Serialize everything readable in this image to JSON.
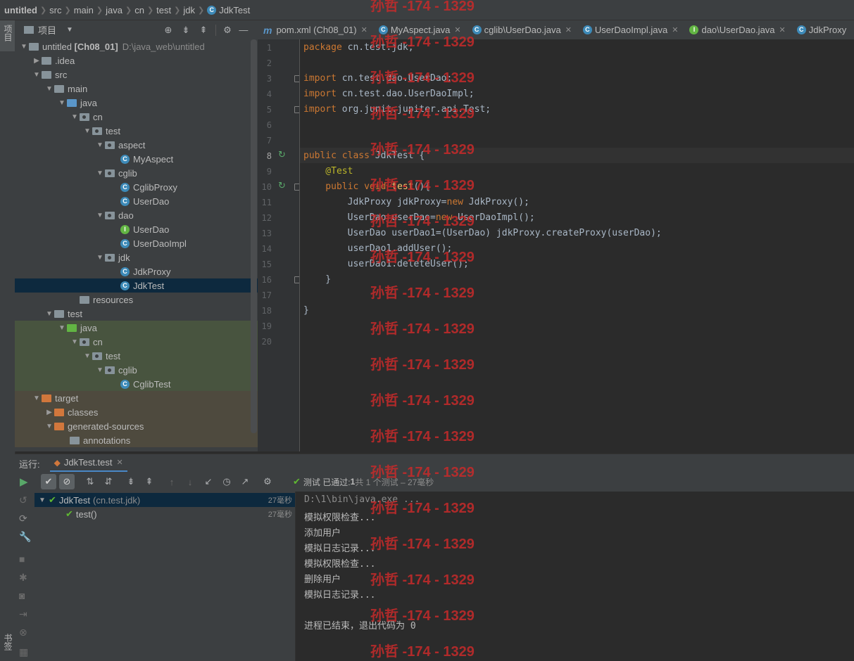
{
  "breadcrumb": [
    "untitled",
    "src",
    "main",
    "java",
    "cn",
    "test",
    "jdk",
    "JdkTest"
  ],
  "left_strip": {
    "project_label": "项目",
    "bookmarks_label": "书签"
  },
  "project_panel": {
    "title": "项目"
  },
  "tree": {
    "root_name": "untitled",
    "root_module": "[Ch08_01]",
    "root_path": "D:\\java_web\\untitled",
    "items": [
      ".idea",
      "src",
      "main",
      "java",
      "cn",
      "test",
      "aspect",
      "MyAspect",
      "cglib",
      "CglibProxy",
      "UserDao",
      "dao",
      "UserDao",
      "UserDaoImpl",
      "jdk",
      "JdkProxy",
      "JdkTest",
      "resources",
      "test",
      "java",
      "cn",
      "test",
      "cglib",
      "CglibTest",
      "target",
      "classes",
      "generated-sources",
      "annotations"
    ]
  },
  "tabs": [
    "pom.xml (Ch08_01)",
    "MyAspect.java",
    "cglib\\UserDao.java",
    "UserDaoImpl.java",
    "dao\\UserDao.java",
    "JdkProxy"
  ],
  "code": {
    "line_numbers": [
      "1",
      "2",
      "3",
      "4",
      "5",
      "6",
      "7",
      "8",
      "9",
      "10",
      "11",
      "12",
      "13",
      "14",
      "15",
      "16",
      "17",
      "18",
      "19",
      "20"
    ],
    "l1_kw": "package",
    "l1_rest": " cn.test.jdk;",
    "l3_kw": "import",
    "l3_rest": " cn.test.dao.UserDao;",
    "l4_kw": "import",
    "l4_rest": " cn.test.dao.UserDaoImpl;",
    "l5_kw": "import",
    "l5_rest": " org.junit.jupiter.api.Test;",
    "l8_kw": "public class",
    "l8_rest": " JdkTest {",
    "l9": "    @Test",
    "l10_kw": "    public void",
    "l10_fn": " test",
    "l10_rest": "(){",
    "l11_a": "        JdkProxy jdkProxy=",
    "l11_kw": "new",
    "l11_b": " JdkProxy();",
    "l12_a": "        UserDao userDao=",
    "l12_kw": "new",
    "l12_b": " UserDaoImpl();",
    "l13": "        UserDao userDao1=(UserDao) jdkProxy.createProxy(userDao);",
    "l14": "        userDao1.addUser();",
    "l15": "        userDao1.deleteUser();",
    "l16": "    }",
    "l18": "}"
  },
  "run": {
    "label": "运行:",
    "tab": "JdkTest.test",
    "status_a": "测试 已通过:",
    "status_b": "1",
    "status_c": "共 1 个测试 – 27毫秒",
    "tree": [
      {
        "name": "JdkTest",
        "detail": "(cn.test.jdk)",
        "time": "27毫秒"
      },
      {
        "name": "test()",
        "detail": "",
        "time": "27毫秒"
      }
    ],
    "console": [
      "D:\\1\\bin\\java.exe ...",
      "模拟权限检查...",
      "添加用户",
      "模拟日志记录...",
      "模拟权限检查...",
      "删除用户",
      "模拟日志记录...",
      "",
      "进程已结束，退出代码为 0"
    ]
  },
  "watermark": "孙哲 -174 - 1329"
}
